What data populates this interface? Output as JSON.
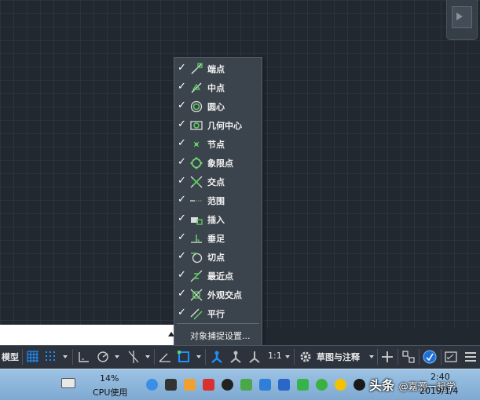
{
  "menu": {
    "items": [
      {
        "label": "端点",
        "checked": "✓",
        "icon": "endpoint-icon"
      },
      {
        "label": "中点",
        "checked": "✓",
        "icon": "midpoint-icon"
      },
      {
        "label": "圆心",
        "checked": "✓",
        "icon": "center-icon"
      },
      {
        "label": "几何中心",
        "checked": "✓",
        "icon": "geometric-center-icon"
      },
      {
        "label": "节点",
        "checked": "✓",
        "icon": "node-icon"
      },
      {
        "label": "象限点",
        "checked": "✓",
        "icon": "quadrant-icon"
      },
      {
        "label": "交点",
        "checked": "✓",
        "icon": "intersection-icon"
      },
      {
        "label": "范围",
        "checked": "✓",
        "icon": "extension-icon"
      },
      {
        "label": "插入",
        "checked": "✓",
        "icon": "insertion-icon"
      },
      {
        "label": "垂足",
        "checked": "✓",
        "icon": "perpendicular-icon"
      },
      {
        "label": "切点",
        "checked": "✓",
        "icon": "tangent-icon"
      },
      {
        "label": "最近点",
        "checked": "✓",
        "icon": "nearest-icon"
      },
      {
        "label": "外观交点",
        "checked": "✓",
        "icon": "apparent-intersection-icon"
      },
      {
        "label": "平行",
        "checked": "✓",
        "icon": "parallel-icon"
      }
    ],
    "settings_label": "对象捕捉设置..."
  },
  "statusbar": {
    "model_label": "模型",
    "scale": "1:1",
    "workspace": "草图与注释"
  },
  "taskbar": {
    "cpu_percent": "14%",
    "cpu_label": "CPU使用",
    "time": "2:40",
    "date": "2019/1/4",
    "watermark_brand": "头条",
    "watermark_text": "@嘉灏一起学"
  },
  "colors": {
    "canvas_bg": "#212830",
    "menu_bg": "#3b434d",
    "accent_blue": "#1e90ff",
    "snap_green": "#5fd35f"
  }
}
